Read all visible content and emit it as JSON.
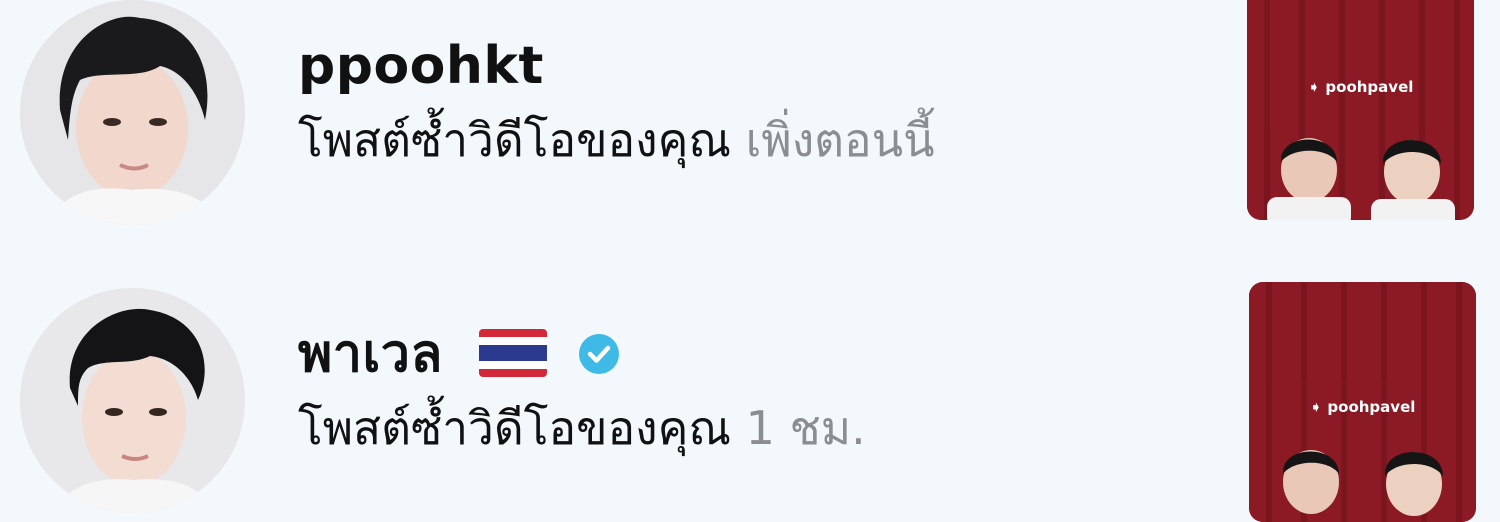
{
  "notifications": [
    {
      "username": "ppoohkt",
      "activity_text": "โพสต์ซ้ำวิดีโอของคุณ",
      "time": "เพิ่งตอนนี้",
      "verified": false,
      "flag": null,
      "thumbnail_label": "➧ poohpavel"
    },
    {
      "username": "พาเวล",
      "activity_text": "โพสต์ซ้ำวิดีโอของคุณ",
      "time": "1 ชม.",
      "verified": true,
      "flag": "thailand-flag",
      "thumbnail_label": "➧ poohpavel"
    }
  ],
  "colors": {
    "background": "#f3f8fc",
    "username": "#111111",
    "time": "#8a8d91",
    "verified_badge": "#3fb9e6",
    "thumbnail_bg": "#8b1a24"
  }
}
